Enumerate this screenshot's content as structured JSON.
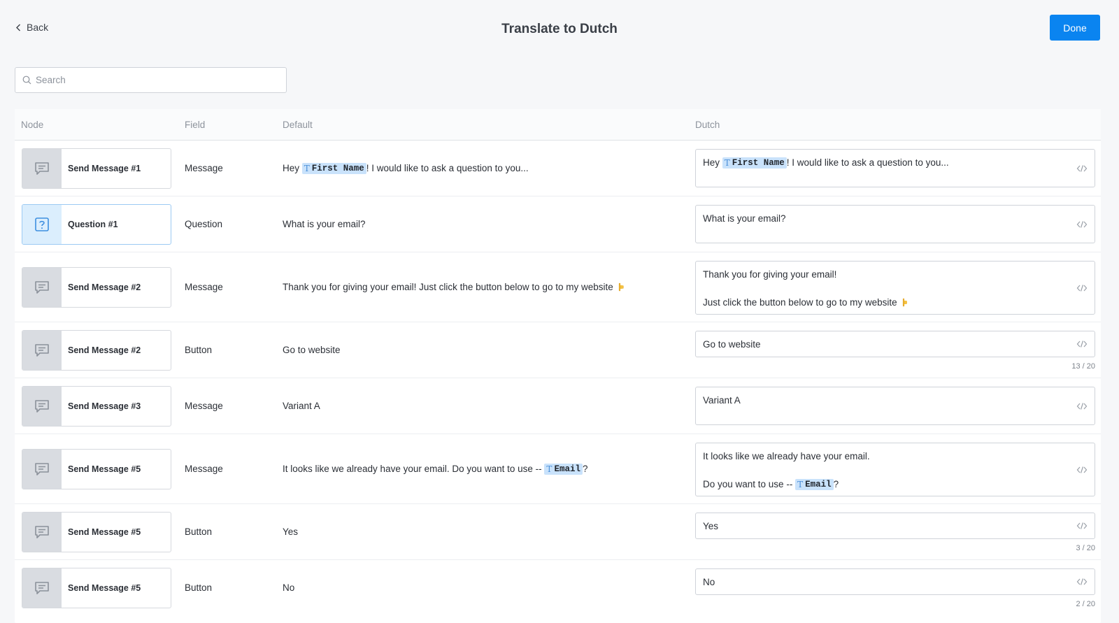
{
  "header": {
    "back_label": "Back",
    "title": "Translate to Dutch",
    "done_label": "Done"
  },
  "search": {
    "placeholder": "Search"
  },
  "columns": [
    "Node",
    "Field",
    "Default",
    "Dutch"
  ],
  "rows": [
    {
      "node_icon": "message-icon",
      "node": "Send Message #1",
      "field": "Message",
      "default": {
        "before": "Hey ",
        "variable": "First Name",
        "after": "! I would like to ask a question to you..."
      },
      "dutch": {
        "line1_before": "Hey ",
        "line1_variable": "First Name",
        "line1_after": "! I would like to ask a question to you..."
      }
    },
    {
      "node_icon": "question-icon",
      "node": "Question #1",
      "field": "Question",
      "default": {
        "text": "What is your email?"
      },
      "dutch": {
        "line1": "What is your email?"
      }
    },
    {
      "node_icon": "message-icon",
      "node": "Send Message #2",
      "field": "Message",
      "default": {
        "text": "Thank you for giving your email! Just click the button below to go to my website",
        "emoji": "pointing-down-icon"
      },
      "dutch": {
        "line1": "Thank you for giving your email!",
        "line2": "Just click the button below to go to my website",
        "emoji": "pointing-down-icon"
      }
    },
    {
      "node_icon": "message-icon",
      "node": "Send Message #2",
      "field": "Button",
      "default": {
        "text": "Go to website"
      },
      "dutch": {
        "line1": "Go to website"
      },
      "counter": "13 / 20"
    },
    {
      "node_icon": "message-icon",
      "node": "Send Message #3",
      "field": "Message",
      "default": {
        "text": "Variant A"
      },
      "dutch": {
        "line1": "Variant A"
      }
    },
    {
      "node_icon": "message-icon",
      "node": "Send Message #5",
      "field": "Message",
      "default": {
        "before": "It looks like we already have your email. Do you want to use -- ",
        "variable": "Email",
        "after": "?"
      },
      "dutch": {
        "line1": "It looks like we already have your email.",
        "line2_before": "Do you want to use -- ",
        "line2_variable": "Email",
        "line2_after": "?"
      }
    },
    {
      "node_icon": "message-icon",
      "node": "Send Message #5",
      "field": "Button",
      "default": {
        "text": "Yes"
      },
      "dutch": {
        "line1": "Yes"
      },
      "counter": "3 / 20"
    },
    {
      "node_icon": "message-icon",
      "node": "Send Message #5",
      "field": "Button",
      "default": {
        "text": "No"
      },
      "dutch": {
        "line1": "No"
      },
      "counter": "2 / 20"
    }
  ],
  "colors": {
    "accent": "#0a84f0",
    "variable_bg": "#c9e2fb",
    "node_icon_bg": "#d9dce1",
    "question_icon_bg": "#dbeefd"
  }
}
